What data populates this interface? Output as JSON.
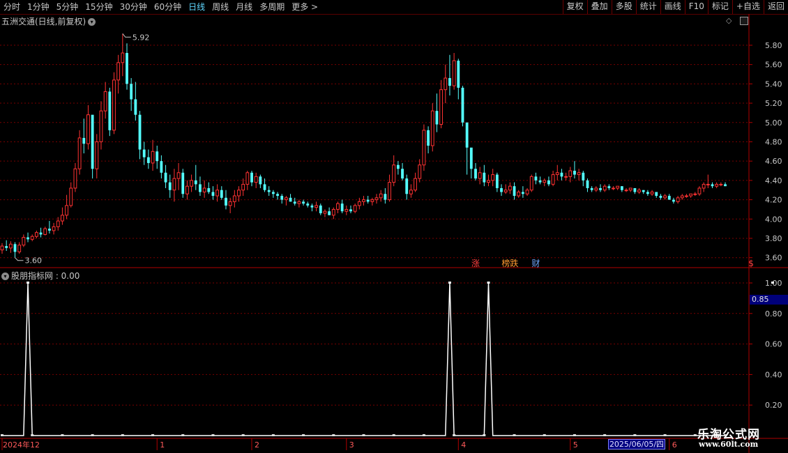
{
  "toolbar": {
    "periods": [
      "分时",
      "1分钟",
      "5分钟",
      "15分钟",
      "30分钟",
      "60分钟",
      "日线",
      "周线",
      "月线",
      "多周期",
      "更多 >"
    ],
    "active_period": "日线",
    "actions": [
      "复权",
      "叠加",
      "多股",
      "统计",
      "画线",
      "F10",
      "标记",
      "+自选",
      "返回"
    ]
  },
  "stock": {
    "title": "五洲交通(日线,前复权)"
  },
  "indicator": {
    "title": "股朋指标网 : 0.00",
    "current_value": "0.85"
  },
  "cursor_date": "2025/06/05/四",
  "watermark": {
    "line1": "乐淘公式网",
    "line2": "www.60lt.com"
  },
  "colors": {
    "up": "#ff3232",
    "down": "#54ffff",
    "grid": "#7a0000",
    "axis": "#b00000",
    "indicator": "#ffffff"
  },
  "events": [
    {
      "text": "涨",
      "x_index": 110
    },
    {
      "text": "榜跌",
      "x_index": 118
    },
    {
      "text": "财",
      "x_index": 124
    },
    {
      "text": "$",
      "x_index": 174
    }
  ],
  "chart_data": [
    {
      "type": "candlestick",
      "title": "五洲交通(日线,前复权)",
      "ylim": [
        3.54,
        5.98
      ],
      "yticks": [
        "5.80",
        "5.60",
        "5.40",
        "5.20",
        "5.00",
        "4.80",
        "4.60",
        "4.40",
        "4.20",
        "4.00",
        "3.80",
        "3.60"
      ],
      "y_min_start": 3.54,
      "high_label": "5.92",
      "low_label": "3.60",
      "x_labels": [
        "2024年12",
        "1",
        "2",
        "3",
        "4",
        "5",
        "6"
      ],
      "x_label_positions": [
        0,
        36,
        58,
        80,
        106,
        132,
        155
      ],
      "ohlc": [
        [
          3.68,
          3.75,
          3.64,
          3.72
        ],
        [
          3.72,
          3.78,
          3.67,
          3.7
        ],
        [
          3.7,
          3.77,
          3.65,
          3.74
        ],
        [
          3.74,
          3.76,
          3.6,
          3.66
        ],
        [
          3.66,
          3.76,
          3.64,
          3.73
        ],
        [
          3.73,
          3.84,
          3.71,
          3.81
        ],
        [
          3.81,
          3.86,
          3.76,
          3.79
        ],
        [
          3.79,
          3.84,
          3.77,
          3.82
        ],
        [
          3.82,
          3.88,
          3.8,
          3.86
        ],
        [
          3.86,
          3.91,
          3.81,
          3.84
        ],
        [
          3.84,
          3.92,
          3.83,
          3.9
        ],
        [
          3.9,
          3.98,
          3.85,
          3.88
        ],
        [
          3.88,
          3.96,
          3.84,
          3.92
        ],
        [
          3.92,
          4.02,
          3.88,
          3.98
        ],
        [
          3.98,
          4.12,
          3.94,
          4.04
        ],
        [
          4.04,
          4.25,
          4.0,
          4.14
        ],
        [
          4.14,
          4.38,
          4.12,
          4.32
        ],
        [
          4.32,
          4.58,
          4.28,
          4.52
        ],
        [
          4.52,
          4.92,
          4.46,
          4.84
        ],
        [
          4.84,
          5.04,
          4.68,
          4.78
        ],
        [
          4.78,
          5.18,
          4.72,
          5.08
        ],
        [
          5.08,
          5.06,
          4.42,
          4.52
        ],
        [
          4.52,
          4.88,
          4.42,
          4.8
        ],
        [
          4.8,
          5.22,
          4.72,
          5.12
        ],
        [
          5.12,
          5.42,
          5.04,
          5.32
        ],
        [
          5.32,
          5.36,
          4.86,
          4.92
        ],
        [
          4.92,
          5.52,
          4.88,
          5.44
        ],
        [
          5.44,
          5.7,
          5.3,
          5.62
        ],
        [
          5.62,
          5.92,
          5.48,
          5.72
        ],
        [
          5.72,
          5.82,
          5.34,
          5.4
        ],
        [
          5.4,
          5.46,
          5.12,
          5.24
        ],
        [
          5.24,
          5.42,
          5.02,
          5.08
        ],
        [
          5.08,
          5.12,
          4.62,
          4.72
        ],
        [
          4.72,
          4.8,
          4.56,
          4.64
        ],
        [
          4.64,
          4.72,
          4.52,
          4.58
        ],
        [
          4.58,
          4.82,
          4.5,
          4.7
        ],
        [
          4.7,
          4.76,
          4.52,
          4.6
        ],
        [
          4.6,
          4.66,
          4.42,
          4.48
        ],
        [
          4.48,
          4.56,
          4.32,
          4.38
        ],
        [
          4.38,
          4.46,
          4.22,
          4.3
        ],
        [
          4.3,
          4.52,
          4.18,
          4.42
        ],
        [
          4.42,
          4.58,
          4.3,
          4.48
        ],
        [
          4.48,
          4.52,
          4.22,
          4.26
        ],
        [
          4.26,
          4.4,
          4.2,
          4.34
        ],
        [
          4.34,
          4.46,
          4.28,
          4.4
        ],
        [
          4.4,
          4.56,
          4.3,
          4.36
        ],
        [
          4.36,
          4.44,
          4.24,
          4.28
        ],
        [
          4.28,
          4.4,
          4.22,
          4.32
        ],
        [
          4.32,
          4.38,
          4.26,
          4.28
        ],
        [
          4.28,
          4.34,
          4.2,
          4.24
        ],
        [
          4.24,
          4.36,
          4.18,
          4.3
        ],
        [
          4.3,
          4.34,
          4.2,
          4.22
        ],
        [
          4.22,
          4.3,
          4.1,
          4.14
        ],
        [
          4.14,
          4.22,
          4.06,
          4.18
        ],
        [
          4.18,
          4.3,
          4.12,
          4.24
        ],
        [
          4.24,
          4.34,
          4.18,
          4.3
        ],
        [
          4.3,
          4.42,
          4.24,
          4.36
        ],
        [
          4.36,
          4.5,
          4.3,
          4.48
        ],
        [
          4.48,
          4.5,
          4.34,
          4.38
        ],
        [
          4.38,
          4.48,
          4.32,
          4.44
        ],
        [
          4.44,
          4.46,
          4.32,
          4.36
        ],
        [
          4.36,
          4.42,
          4.28,
          4.3
        ],
        [
          4.3,
          4.34,
          4.24,
          4.28
        ],
        [
          4.28,
          4.3,
          4.22,
          4.26
        ],
        [
          4.26,
          4.28,
          4.2,
          4.24
        ],
        [
          4.24,
          4.26,
          4.16,
          4.2
        ],
        [
          4.2,
          4.24,
          4.14,
          4.22
        ],
        [
          4.22,
          4.26,
          4.18,
          4.18
        ],
        [
          4.18,
          4.22,
          4.14,
          4.16
        ],
        [
          4.16,
          4.2,
          4.12,
          4.18
        ],
        [
          4.18,
          4.2,
          4.14,
          4.16
        ],
        [
          4.16,
          4.18,
          4.12,
          4.14
        ],
        [
          4.14,
          4.16,
          4.08,
          4.12
        ],
        [
          4.12,
          4.18,
          4.08,
          4.14
        ],
        [
          4.14,
          4.16,
          4.04,
          4.06
        ],
        [
          4.06,
          4.1,
          4.02,
          4.08
        ],
        [
          4.08,
          4.12,
          4.04,
          4.04
        ],
        [
          4.04,
          4.12,
          4.0,
          4.1
        ],
        [
          4.1,
          4.18,
          4.06,
          4.16
        ],
        [
          4.16,
          4.2,
          4.06,
          4.08
        ],
        [
          4.08,
          4.14,
          4.04,
          4.1
        ],
        [
          4.1,
          4.14,
          4.06,
          4.08
        ],
        [
          4.08,
          4.16,
          4.06,
          4.14
        ],
        [
          4.14,
          4.22,
          4.1,
          4.18
        ],
        [
          4.18,
          4.24,
          4.14,
          4.2
        ],
        [
          4.2,
          4.24,
          4.16,
          4.18
        ],
        [
          4.18,
          4.22,
          4.14,
          4.2
        ],
        [
          4.2,
          4.26,
          4.16,
          4.22
        ],
        [
          4.22,
          4.3,
          4.18,
          4.26
        ],
        [
          4.26,
          4.32,
          4.16,
          4.2
        ],
        [
          4.2,
          4.46,
          4.18,
          4.38
        ],
        [
          4.38,
          4.66,
          4.34,
          4.56
        ],
        [
          4.56,
          4.6,
          4.46,
          4.52
        ],
        [
          4.52,
          4.58,
          4.4,
          4.42
        ],
        [
          4.42,
          4.46,
          4.2,
          4.26
        ],
        [
          4.26,
          4.36,
          4.22,
          4.3
        ],
        [
          4.3,
          4.48,
          4.28,
          4.42
        ],
        [
          4.42,
          4.62,
          4.38,
          4.56
        ],
        [
          4.56,
          4.98,
          4.5,
          4.92
        ],
        [
          4.92,
          4.96,
          4.68,
          4.76
        ],
        [
          4.76,
          5.2,
          4.7,
          5.12
        ],
        [
          5.12,
          5.3,
          4.9,
          4.98
        ],
        [
          4.98,
          5.44,
          4.94,
          5.34
        ],
        [
          5.34,
          5.6,
          5.2,
          5.46
        ],
        [
          5.46,
          5.7,
          5.28,
          5.38
        ],
        [
          5.38,
          5.72,
          5.34,
          5.64
        ],
        [
          5.64,
          5.66,
          5.24,
          5.36
        ],
        [
          5.36,
          5.38,
          4.96,
          5.0
        ],
        [
          5.0,
          4.84,
          4.46,
          4.74
        ],
        [
          4.74,
          4.7,
          4.42,
          4.52
        ],
        [
          4.52,
          4.58,
          4.4,
          4.42
        ],
        [
          4.42,
          4.54,
          4.36,
          4.48
        ],
        [
          4.48,
          4.56,
          4.34,
          4.38
        ],
        [
          4.38,
          4.46,
          4.34,
          4.4
        ],
        [
          4.4,
          4.52,
          4.34,
          4.46
        ],
        [
          4.46,
          4.48,
          4.28,
          4.32
        ],
        [
          4.32,
          4.36,
          4.24,
          4.28
        ],
        [
          4.28,
          4.36,
          4.26,
          4.3
        ],
        [
          4.3,
          4.38,
          4.26,
          4.34
        ],
        [
          4.34,
          4.38,
          4.2,
          4.24
        ],
        [
          4.24,
          4.3,
          4.22,
          4.28
        ],
        [
          4.28,
          4.34,
          4.22,
          4.26
        ],
        [
          4.26,
          4.32,
          4.24,
          4.3
        ],
        [
          4.3,
          4.46,
          4.28,
          4.44
        ],
        [
          4.44,
          4.48,
          4.36,
          4.4
        ],
        [
          4.4,
          4.44,
          4.36,
          4.38
        ],
        [
          4.38,
          4.42,
          4.34,
          4.4
        ],
        [
          4.4,
          4.44,
          4.34,
          4.36
        ],
        [
          4.36,
          4.5,
          4.34,
          4.46
        ],
        [
          4.46,
          4.56,
          4.4,
          4.48
        ],
        [
          4.48,
          4.52,
          4.4,
          4.44
        ],
        [
          4.44,
          4.48,
          4.4,
          4.44
        ],
        [
          4.44,
          4.54,
          4.38,
          4.5
        ],
        [
          4.5,
          4.6,
          4.42,
          4.46
        ],
        [
          4.46,
          4.52,
          4.4,
          4.48
        ],
        [
          4.48,
          4.5,
          4.34,
          4.4
        ],
        [
          4.4,
          4.42,
          4.28,
          4.32
        ],
        [
          4.32,
          4.34,
          4.28,
          4.3
        ],
        [
          4.3,
          4.34,
          4.28,
          4.32
        ],
        [
          4.32,
          4.36,
          4.28,
          4.3
        ],
        [
          4.3,
          4.36,
          4.28,
          4.34
        ],
        [
          4.34,
          4.36,
          4.3,
          4.32
        ],
        [
          4.32,
          4.34,
          4.3,
          4.32
        ],
        [
          4.32,
          4.34,
          4.3,
          4.34
        ],
        [
          4.34,
          4.34,
          4.28,
          4.3
        ],
        [
          4.3,
          4.32,
          4.28,
          4.3
        ],
        [
          4.3,
          4.32,
          4.28,
          4.32
        ],
        [
          4.32,
          4.32,
          4.26,
          4.28
        ],
        [
          4.28,
          4.32,
          4.26,
          4.3
        ],
        [
          4.3,
          4.3,
          4.26,
          4.28
        ],
        [
          4.28,
          4.3,
          4.24,
          4.26
        ],
        [
          4.26,
          4.3,
          4.24,
          4.28
        ],
        [
          4.28,
          4.28,
          4.22,
          4.24
        ],
        [
          4.24,
          4.26,
          4.2,
          4.22
        ],
        [
          4.22,
          4.26,
          4.2,
          4.24
        ],
        [
          4.24,
          4.26,
          4.2,
          4.2
        ],
        [
          4.2,
          4.22,
          4.16,
          4.18
        ],
        [
          4.18,
          4.24,
          4.16,
          4.22
        ],
        [
          4.22,
          4.26,
          4.2,
          4.24
        ],
        [
          4.24,
          4.26,
          4.22,
          4.24
        ],
        [
          4.24,
          4.26,
          4.22,
          4.26
        ],
        [
          4.26,
          4.28,
          4.24,
          4.26
        ],
        [
          4.26,
          4.34,
          4.24,
          4.32
        ],
        [
          4.32,
          4.38,
          4.28,
          4.36
        ],
        [
          4.36,
          4.46,
          4.32,
          4.36
        ],
        [
          4.36,
          4.38,
          4.32,
          4.34
        ],
        [
          4.34,
          4.38,
          4.32,
          4.36
        ],
        [
          4.36,
          4.38,
          4.34,
          4.36
        ],
        [
          4.36,
          4.38,
          4.34,
          4.34
        ]
      ]
    },
    {
      "type": "line",
      "title": "股朋指标网",
      "ylim": [
        0,
        1.0
      ],
      "yticks": [
        "1.00",
        "0.80",
        "0.60",
        "0.40",
        "0.20"
      ],
      "spikes": [
        {
          "x_index": 6,
          "value": 1.0
        },
        {
          "x_index": 104,
          "value": 1.0
        },
        {
          "x_index": 113,
          "value": 1.0
        },
        {
          "x_index": 179,
          "value": 1.0
        }
      ],
      "baseline": 0.0
    }
  ]
}
